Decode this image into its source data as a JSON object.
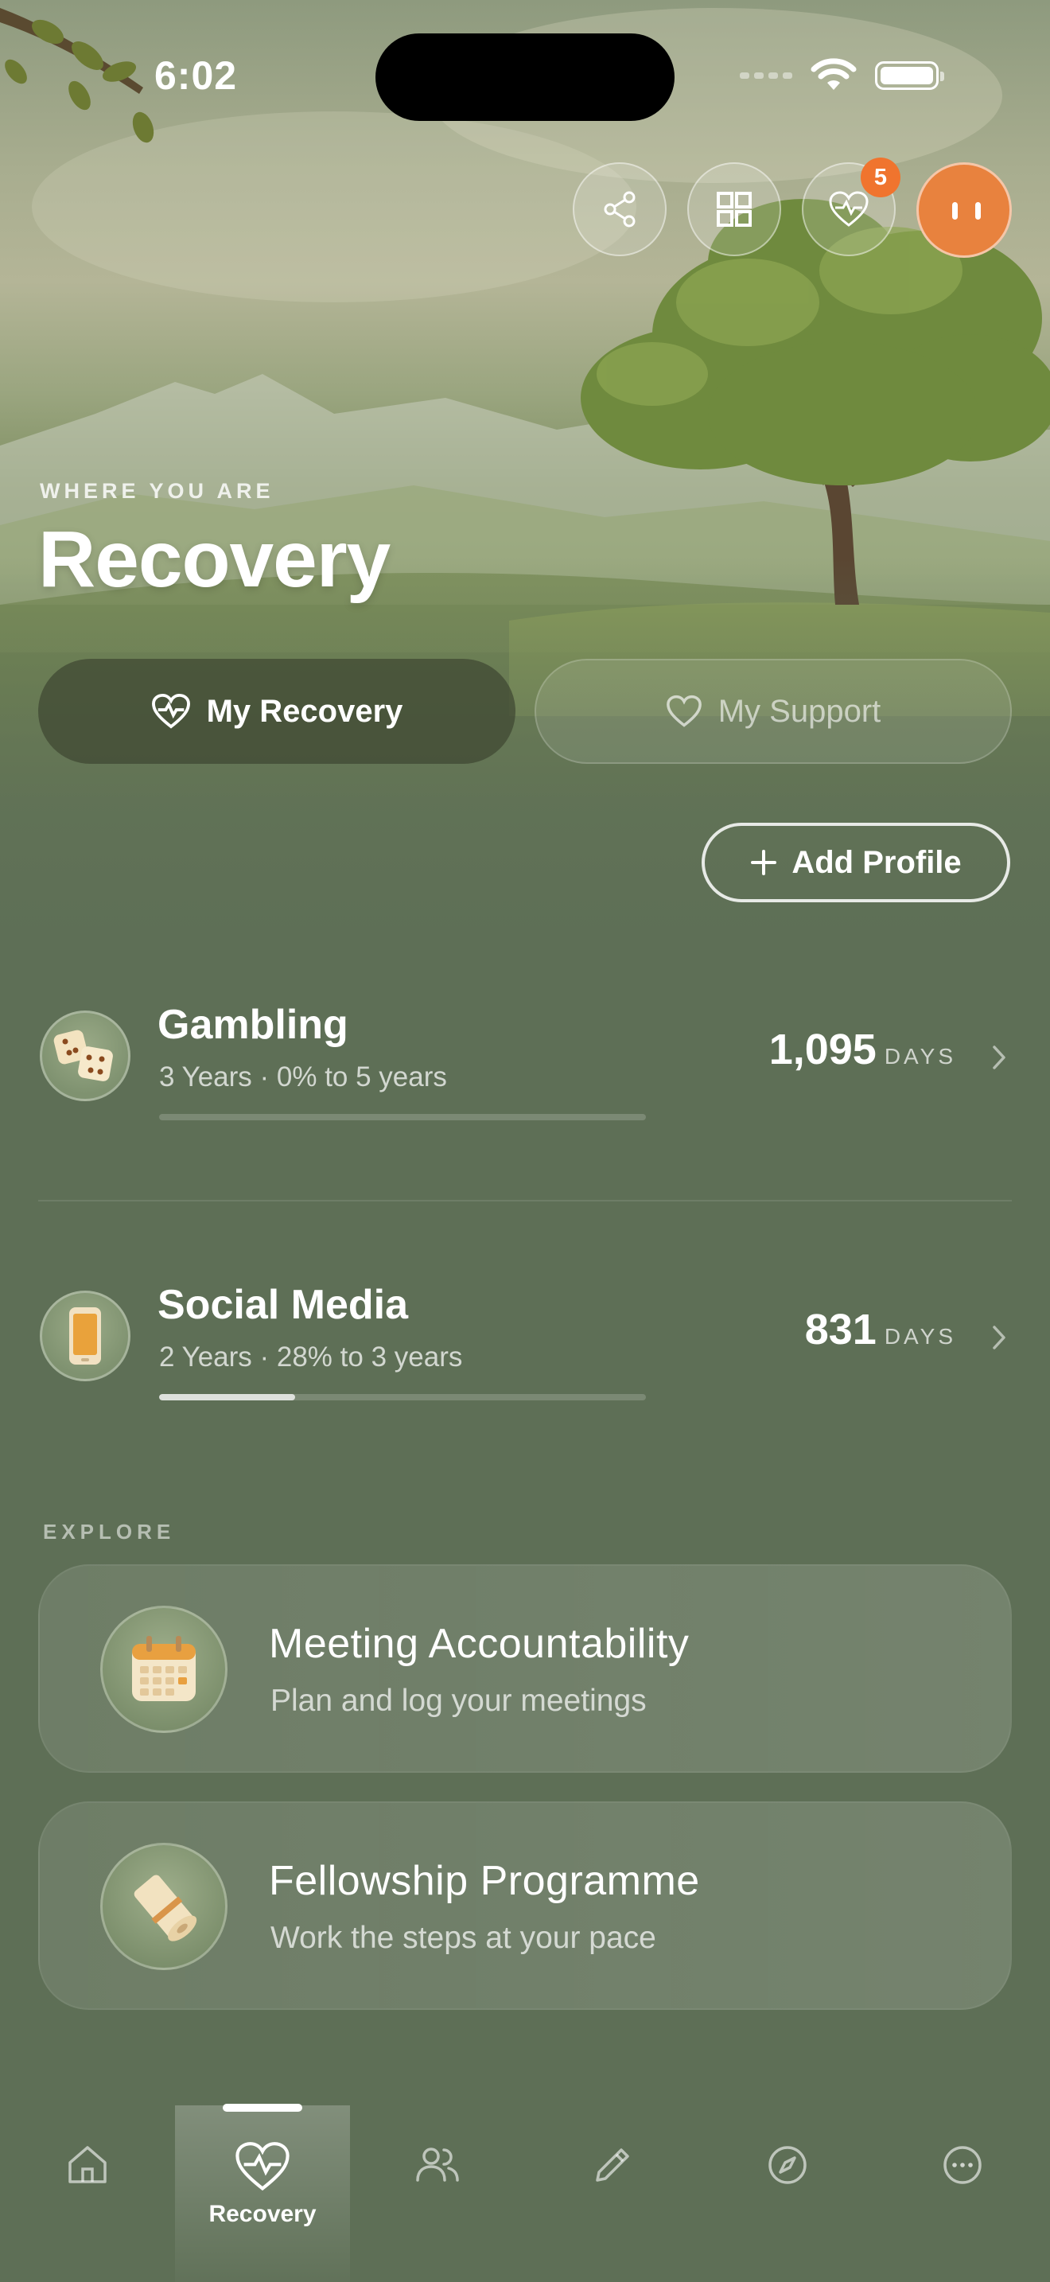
{
  "status_bar": {
    "time": "6:02"
  },
  "top_actions": {
    "notification_count": "5"
  },
  "header": {
    "eyebrow": "WHERE YOU ARE",
    "title": "Recovery"
  },
  "segments": {
    "active_label": "My Recovery",
    "inactive_label": "My Support"
  },
  "add_profile_label": "Add Profile",
  "recoveries": [
    {
      "title": "Gambling",
      "subtitle": "3 Years · 0% to 5 years",
      "count": "1,095",
      "unit": "DAYS",
      "progress": 0.0,
      "icon": "dice-icon"
    },
    {
      "title": "Social Media",
      "subtitle": "2 Years · 28% to 3 years",
      "count": "831",
      "unit": "DAYS",
      "progress": 0.28,
      "icon": "phone-icon"
    }
  ],
  "explore": {
    "label": "EXPLORE",
    "cards": [
      {
        "title": "Meeting Accountability",
        "subtitle": "Plan and log your meetings",
        "icon": "calendar-icon"
      },
      {
        "title": "Fellowship Programme",
        "subtitle": "Work the steps at your pace",
        "icon": "scroll-icon"
      }
    ]
  },
  "tabbar": {
    "active_label": "Recovery",
    "tabs": [
      "home-icon",
      "heartbeat-icon",
      "people-icon",
      "pencil-icon",
      "compass-icon",
      "more-icon"
    ]
  }
}
